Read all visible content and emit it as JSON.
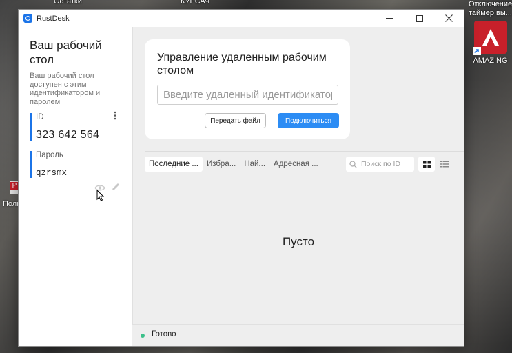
{
  "desktop": {
    "top_text_1": "Остатки",
    "top_text_2": "КУРСАЧ",
    "right_icon_top_label": "Отключение таймер вы...",
    "amazing_label": "AMAZING",
    "left_label": "Полн"
  },
  "window": {
    "title": "RustDesk",
    "controls": {
      "minimize": "—",
      "maximize": "☐",
      "close": "✕"
    }
  },
  "sidebar": {
    "title": "Ваш рабочий стол",
    "description": "Ваш рабочий стол доступен с этим идентификатором и паролем",
    "id_label": "ID",
    "id_value": "323 642 564",
    "password_label": "Пароль",
    "password_value": "qzrsmx"
  },
  "connect": {
    "title": "Управление удаленным рабочим столом",
    "input_placeholder": "Введите удаленный идентификатор",
    "file_button": "Передать файл",
    "connect_button": "Подключиться"
  },
  "tabs": [
    {
      "label": "Последние ..."
    },
    {
      "label": "Избра..."
    },
    {
      "label": "Най..."
    },
    {
      "label": "Адресная ..."
    }
  ],
  "search": {
    "placeholder": "Поиск по ID"
  },
  "content": {
    "empty_text": "Пусто"
  },
  "status": {
    "text": "Готово",
    "color": "#3cc08a"
  },
  "colors": {
    "accent": "#2c8cf4",
    "brand": "#1b74e8"
  }
}
